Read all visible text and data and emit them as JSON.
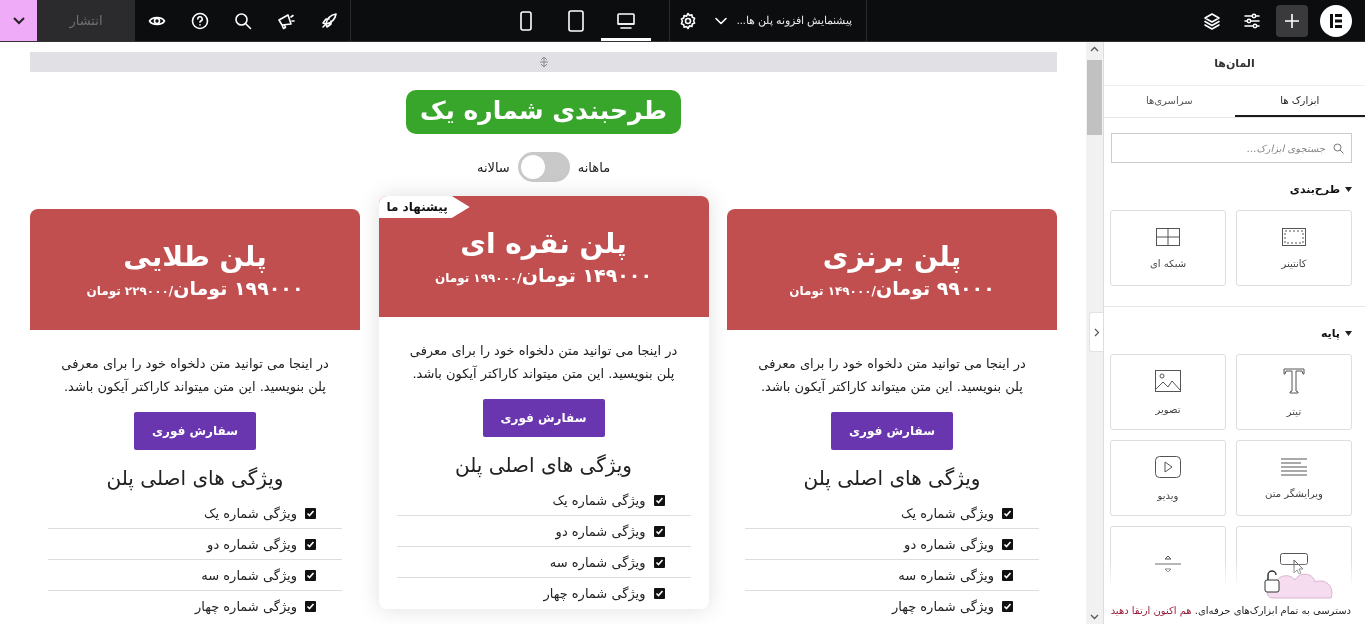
{
  "top_bar": {
    "publish_button": "انتشار",
    "page_title": "پیشنمایش افزونه پلن ها...",
    "devices": [
      {
        "kind": "mobile",
        "selected": false
      },
      {
        "kind": "tablet",
        "selected": false
      },
      {
        "kind": "desktop",
        "selected": true
      }
    ]
  },
  "canvas": {
    "title": "طرحبندی شماره یک",
    "billing_toggle": {
      "monthly_label": "ماهانه",
      "yearly_label": "سالانه",
      "on": false
    },
    "plans": [
      {
        "name": "پلن برنزی",
        "price": "۹۹۰۰۰ تومان",
        "old_price": "/۱۴۹۰۰۰ تومان",
        "featured": false,
        "description": "در اینجا می توانید متن دلخواه خود را برای معرفی پلن بنویسید. این متن میتواند کاراکتر آیکون باشد.",
        "button": "سفارش فوری",
        "features_title": "ویژگی های اصلی پلن",
        "features": [
          {
            "text": "ویژگی شماره یک",
            "checked": true
          },
          {
            "text": "ویژگی شماره دو",
            "checked": true
          },
          {
            "text": "ویژگی شماره سه",
            "checked": true
          },
          {
            "text": "ویژگی شماره چهار",
            "checked": true
          }
        ]
      },
      {
        "name": "پلن نقره ای",
        "price": "۱۴۹۰۰۰ تومان",
        "old_price": "/۱۹۹۰۰۰ تومان",
        "featured": true,
        "badge": "پیشنهاد ما",
        "description": "در اینجا می توانید متن دلخواه خود را برای معرفی پلن بنویسید. این متن میتواند کاراکتر آیکون باشد.",
        "button": "سفارش فوری",
        "features_title": "ویژگی های اصلی پلن",
        "features": [
          {
            "text": "ویژگی شماره یک",
            "checked": true
          },
          {
            "text": "ویژگی شماره دو",
            "checked": true
          },
          {
            "text": "ویژگی شماره سه",
            "checked": true
          },
          {
            "text": "ویژگی شماره چهار",
            "checked": true
          }
        ]
      },
      {
        "name": "پلن طلایی",
        "price": "۱۹۹۰۰۰ تومان",
        "old_price": "/۲۲۹۰۰۰ تومان",
        "featured": false,
        "description": "در اینجا می توانید متن دلخواه خود را برای معرفی پلن بنویسید. این متن میتواند کاراکتر آیکون باشد.",
        "button": "سفارش فوری",
        "features_title": "ویژگی های اصلی پلن",
        "features": [
          {
            "text": "ویژگی شماره یک",
            "checked": true
          },
          {
            "text": "ویژگی شماره دو",
            "checked": true
          },
          {
            "text": "ویژگی شماره سه",
            "checked": true
          },
          {
            "text": "ویژگی شماره چهار",
            "checked": true
          }
        ]
      }
    ]
  },
  "panel": {
    "title": "المان‌ها",
    "tabs": [
      {
        "label": "ابزارک ها",
        "selected": true
      },
      {
        "label": "سراسری‌ها",
        "selected": false
      }
    ],
    "search": {
      "placeholder": "جستجوی ابزارک..."
    },
    "sections": [
      {
        "title": "طرح‌بندی",
        "expanded": true,
        "widgets": [
          {
            "kind": "container",
            "label": "کانتینر"
          },
          {
            "kind": "grid",
            "label": "شبکه ای"
          }
        ]
      },
      {
        "title": "پایه",
        "expanded": true,
        "widgets": [
          {
            "kind": "heading",
            "label": "تیتر"
          },
          {
            "kind": "image",
            "label": "تصویر"
          },
          {
            "kind": "text-editor",
            "label": "ویرایشگر متن"
          },
          {
            "kind": "video",
            "label": "ویدیو"
          },
          {
            "kind": "button"
          },
          {
            "kind": "divider"
          }
        ]
      }
    ],
    "promo": {
      "text": "دسترسی به تمام ابزارک‌های حرفه‌ای.",
      "link": "هم اکنون ارتقا دهید"
    }
  }
}
